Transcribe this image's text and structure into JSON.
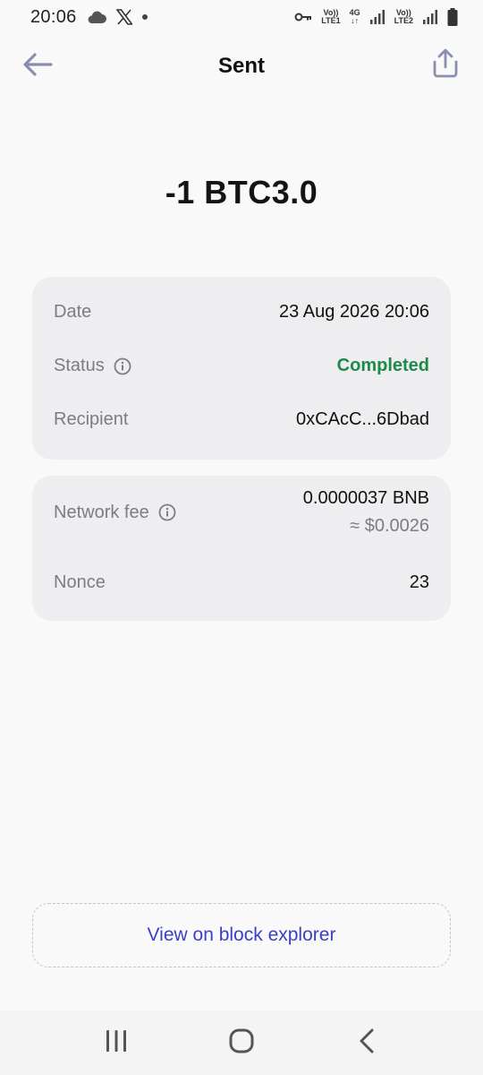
{
  "status_bar": {
    "time": "20:06",
    "icons": [
      "cloud-icon",
      "x-logo-icon",
      "dot-icon",
      "key-icon",
      "volte-lte1-icon",
      "4g-icon",
      "signal-icon",
      "volte-lte2-icon",
      "signal-icon",
      "battery-icon"
    ],
    "lte1_top": "Vo))",
    "lte1_bottom": "LTE1",
    "net_top": "4G",
    "lte2_top": "Vo))",
    "lte2_bottom": "LTE2"
  },
  "header": {
    "title": "Sent",
    "back_icon": "arrow-left-icon",
    "share_icon": "share-icon"
  },
  "amount": "-1 BTC3.0",
  "details": {
    "date_label": "Date",
    "date_value": "23 Aug 2026 20:06",
    "status_label": "Status",
    "status_value": "Completed",
    "recipient_label": "Recipient",
    "recipient_value": "0xCAcC...6Dbad"
  },
  "fees": {
    "fee_label": "Network fee",
    "fee_value": "0.0000037 BNB",
    "fee_usd": "≈ $0.0026",
    "nonce_label": "Nonce",
    "nonce_value": "23"
  },
  "explorer_button": "View on block explorer",
  "colors": {
    "accent": "#3b3fc4",
    "success": "#1e8a4a",
    "card_bg": "#eeeef0",
    "label": "#7c7c88"
  }
}
